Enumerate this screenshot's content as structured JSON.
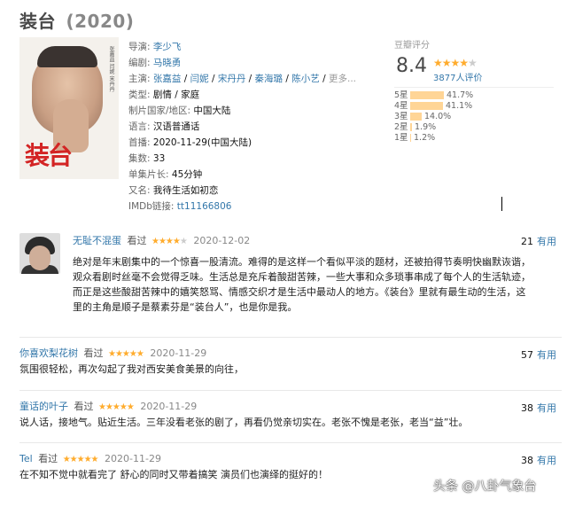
{
  "title": "装台",
  "year": "(2020)",
  "poster": {
    "title_text": "装台",
    "side_text": "张嘉益 闫妮 宋丹丹"
  },
  "info": {
    "director": {
      "key": "导演:",
      "value": "李少飞"
    },
    "writer": {
      "key": "编剧:",
      "value": "马晓勇"
    },
    "cast": {
      "key": "主演:",
      "names": [
        "张嘉益",
        "闫妮",
        "宋丹丹",
        "秦海璐",
        "陈小艺"
      ],
      "more": "更多..."
    },
    "genre": {
      "key": "类型:",
      "value": "剧情 / 家庭"
    },
    "country": {
      "key": "制片国家/地区:",
      "value": "中国大陆"
    },
    "language": {
      "key": "语言:",
      "value": "汉语普通话"
    },
    "premiere": {
      "key": "首播:",
      "value": "2020-11-29(中国大陆)"
    },
    "episodes": {
      "key": "集数:",
      "value": "33"
    },
    "runtime": {
      "key": "单集片长:",
      "value": "45分钟"
    },
    "aka": {
      "key": "又名:",
      "value": "我待生活如初恋"
    },
    "imdb": {
      "key": "IMDb链接:",
      "value": "tt11166806"
    }
  },
  "rating": {
    "label": "豆瓣评分",
    "score": "8.4",
    "stars": 4,
    "count": "3877人评价",
    "bars": [
      {
        "label": "5星",
        "pct": "41.7%",
        "value": 41.7
      },
      {
        "label": "4星",
        "pct": "41.1%",
        "value": 41.1
      },
      {
        "label": "3星",
        "pct": "14.0%",
        "value": 14.0
      },
      {
        "label": "2星",
        "pct": "1.9%",
        "value": 1.9
      },
      {
        "label": "1星",
        "pct": "1.2%",
        "value": 1.2
      }
    ]
  },
  "reviews": [
    {
      "user": "无耻不混蛋",
      "watched": "看过",
      "stars": 4,
      "date": "2020-12-02",
      "useful_count": "21",
      "useful_label": "有用",
      "lines": [
        "绝对是年末剧集中的一个惊喜一股清流。难得的是这样一个看似平淡的题材，还被拍得节奏明快幽默诙谐，",
        "观众看剧时丝毫不会觉得乏味。生活总是充斥着酸甜苦辣，一些大事和众多琐事串成了每个人的生活轨迹，",
        "而正是这些酸甜苦辣中的嬉笑怒骂、情感交织才是生活中最动人的地方。《装台》里就有最生动的生活，这",
        "里的主角是顺子是蔡素芬是“装台人”，也是你是我。"
      ]
    },
    {
      "user": "你喜欢梨花树",
      "watched": "看过",
      "stars": 5,
      "date": "2020-11-29",
      "useful_count": "57",
      "useful_label": "有用",
      "lines": [
        "氛围很轻松，再次勾起了我对西安美食美景的向往，"
      ]
    },
    {
      "user": "童话的叶子",
      "watched": "看过",
      "stars": 5,
      "date": "2020-11-29",
      "useful_count": "38",
      "useful_label": "有用",
      "lines": [
        "说人话，接地气。贴近生活。三年没看老张的剧了，再看仍觉亲切实在。老张不愧是老张，老当“益”壮。"
      ]
    },
    {
      "user": "Tel",
      "watched": "看过",
      "stars": 5,
      "date": "2020-11-29",
      "useful_count": "38",
      "useful_label": "有用",
      "lines": [
        "在不知不觉中就看完了 舒心的同时又带着搞笑 演员们也演绎的挺好的！"
      ]
    }
  ],
  "watermark": "头条 @八卦气象台"
}
